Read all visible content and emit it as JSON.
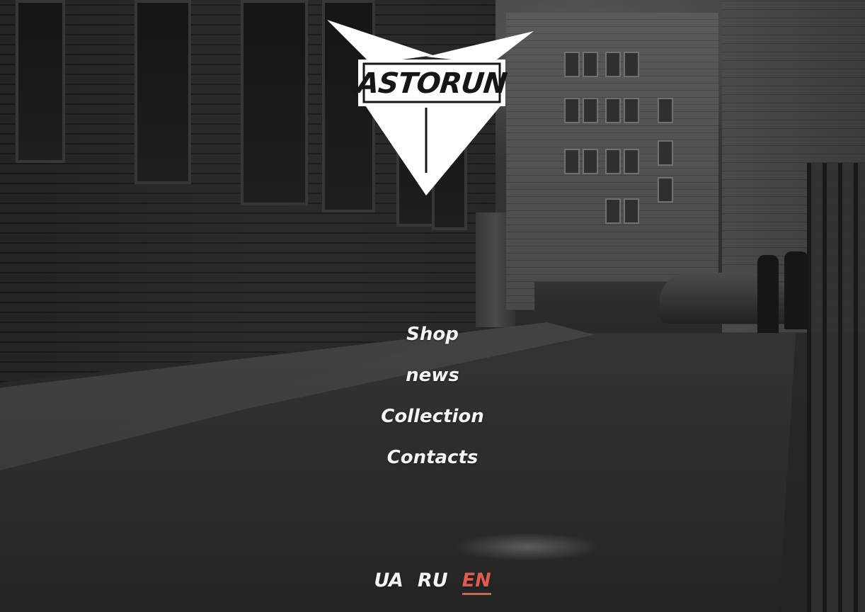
{
  "logo": {
    "text": "ASTORUN",
    "icon": "winged-arrow-logo"
  },
  "nav": {
    "items": [
      {
        "label": "Shop"
      },
      {
        "label": "news"
      },
      {
        "label": "Collection"
      },
      {
        "label": "Contacts"
      }
    ]
  },
  "languages": {
    "items": [
      {
        "label": "UA",
        "active": false
      },
      {
        "label": "RU",
        "active": false
      },
      {
        "label": "EN",
        "active": true
      }
    ],
    "active_color": "#e05a4e"
  },
  "colors": {
    "text": "#f4f4f4",
    "accent": "#e05a4e",
    "logo_fill": "#ffffff"
  }
}
